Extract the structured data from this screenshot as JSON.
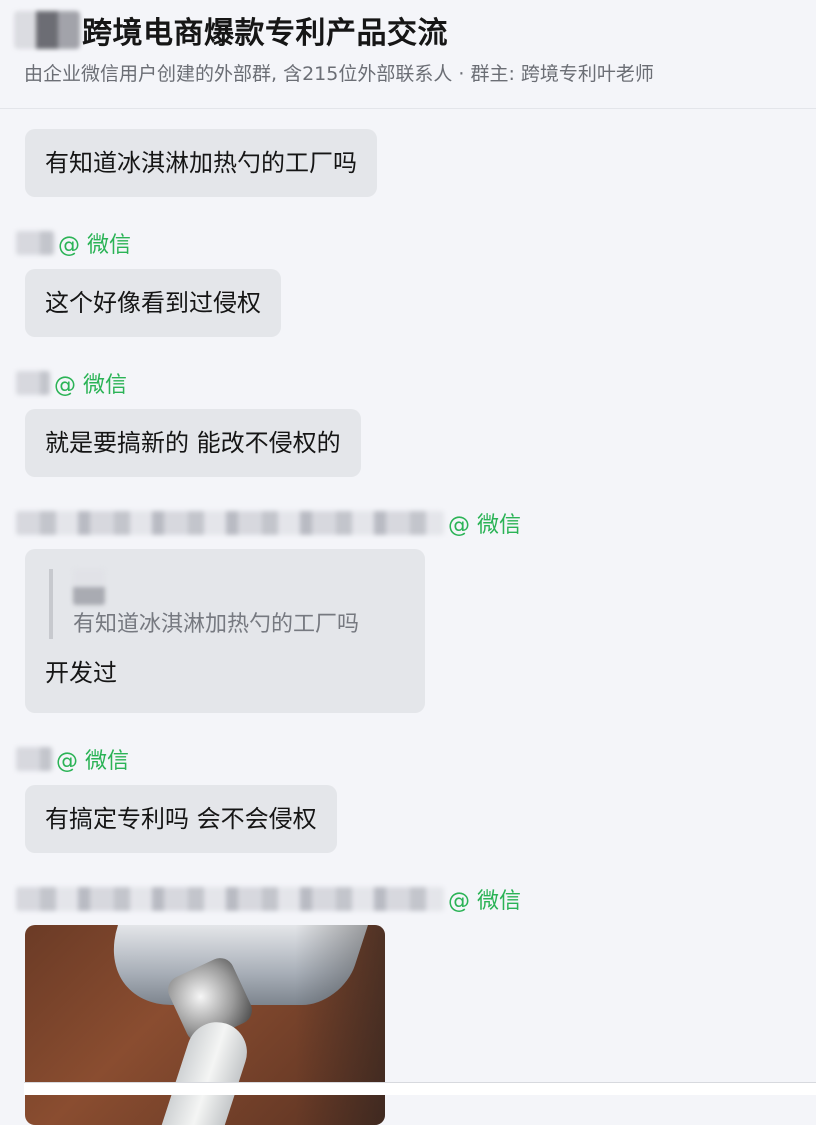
{
  "header": {
    "title": "跨境电商爆款专利产品交流",
    "subtitle": "由企业微信用户创建的外部群, 含215位外部联系人 · 群主: 跨境专利叶老师"
  },
  "wechat_tag": "@ 微信",
  "messages": [
    {
      "text": "有知道冰淇淋加热勺的工厂吗"
    },
    {
      "text": "这个好像看到过侵权"
    },
    {
      "text": "就是要搞新的  能改不侵权的"
    },
    {
      "quote": "有知道冰淇淋加热勺的工厂吗",
      "text": "开发过"
    },
    {
      "text": "有搞定专利吗  会不会侵权"
    }
  ],
  "colors": {
    "wechat_green": "#2bb356",
    "bubble": "#e4e6ea",
    "background": "#f4f5f9"
  }
}
